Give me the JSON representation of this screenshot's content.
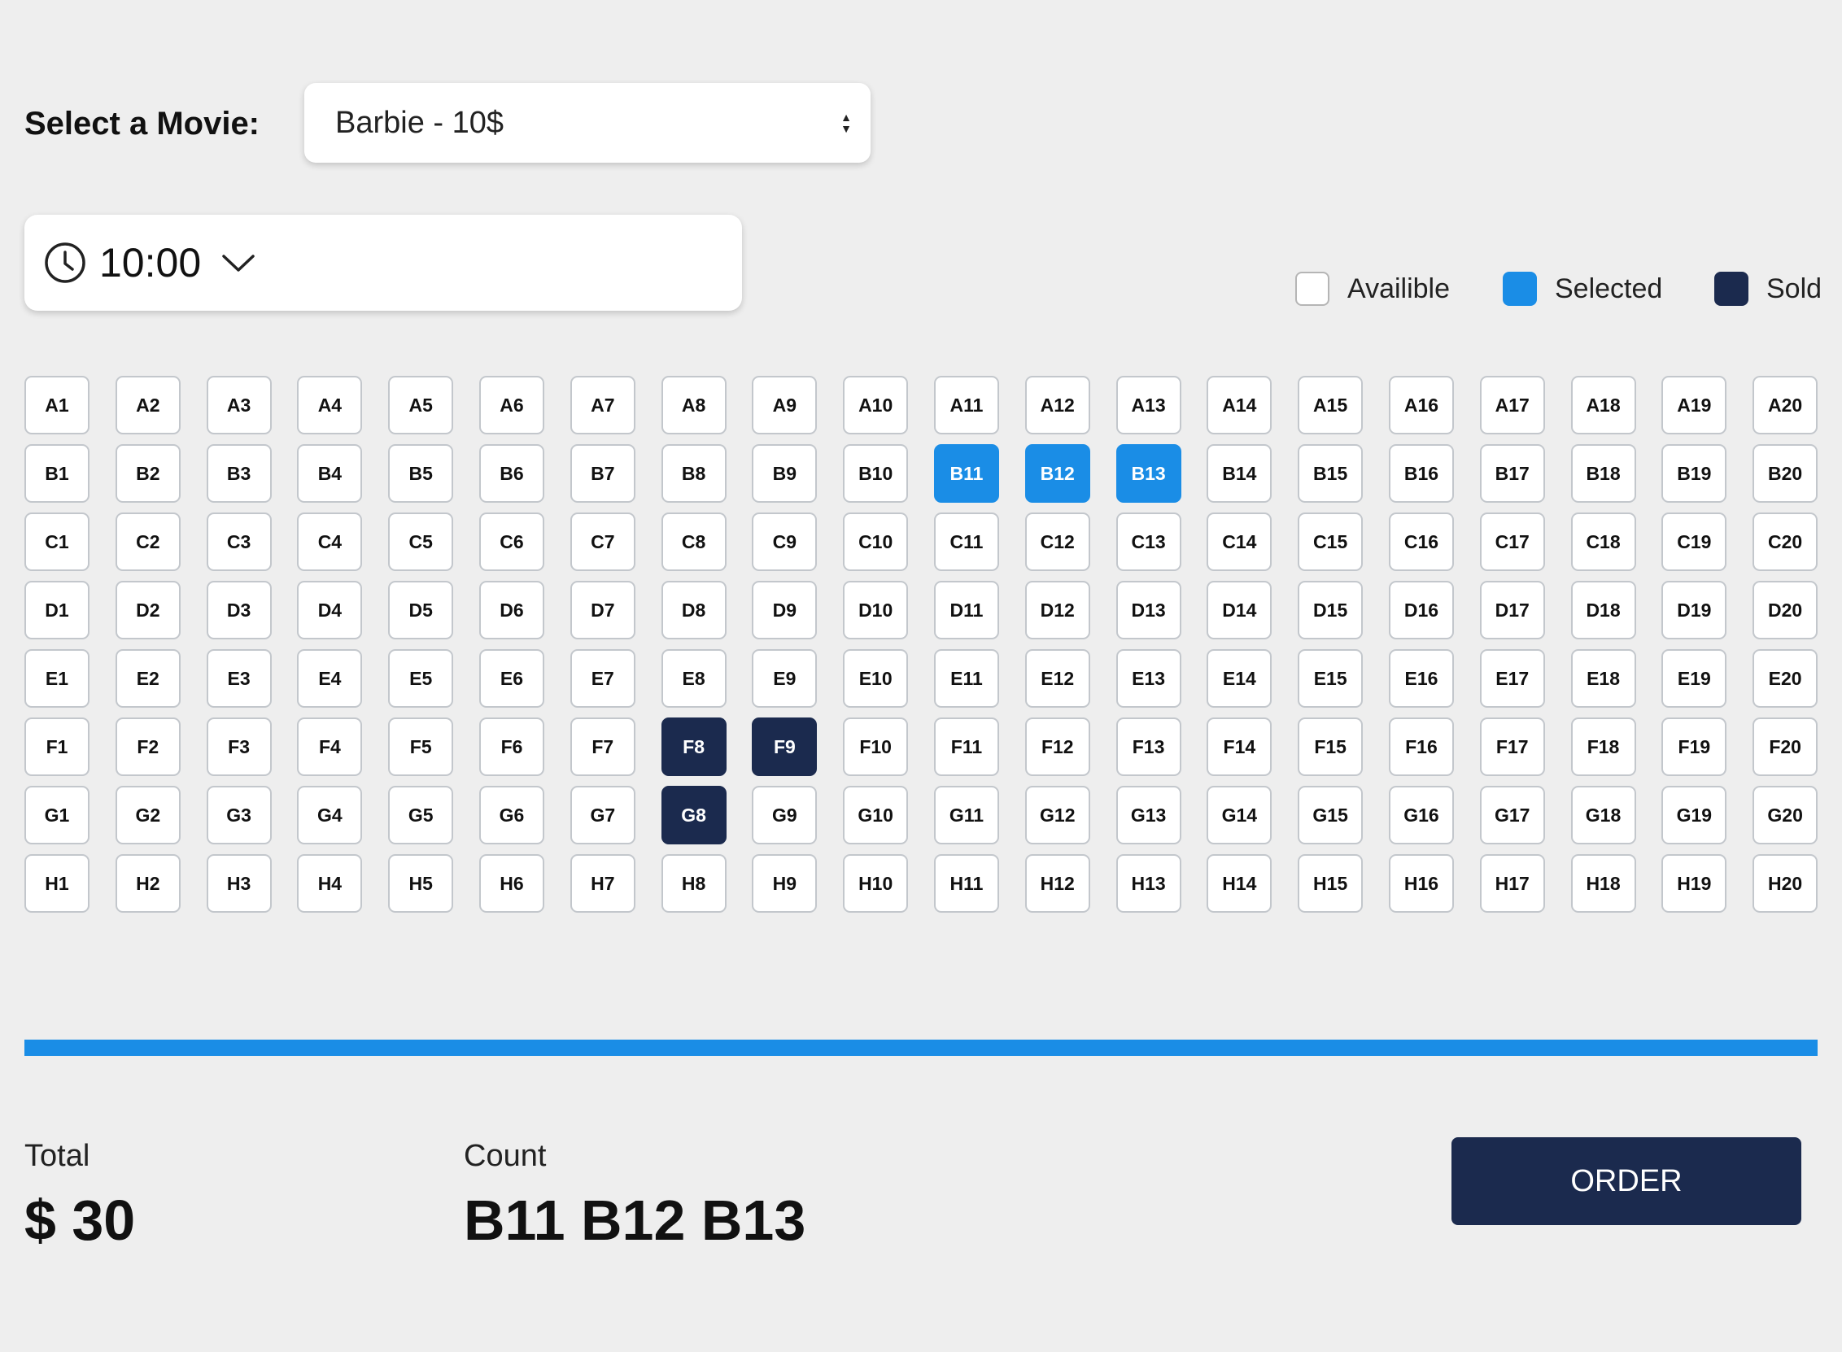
{
  "movie": {
    "label": "Select a Movie:",
    "selected": "Barbie - 10$"
  },
  "showtime": {
    "selected": "10:00"
  },
  "legend": {
    "available": "Availible",
    "selected": "Selected",
    "sold": "Sold"
  },
  "colors": {
    "selected": "#1a8de6",
    "sold": "#1b2a4e",
    "available": "#ffffff",
    "background": "#eeeeee"
  },
  "seat_grid": {
    "rows": [
      "A",
      "B",
      "C",
      "D",
      "E",
      "F",
      "G",
      "H"
    ],
    "seats_per_row": 20,
    "selected": [
      "B11",
      "B12",
      "B13"
    ],
    "sold": [
      "F8",
      "F9",
      "G8"
    ]
  },
  "summary": {
    "total_label": "Total",
    "total_value": "$ 30",
    "count_label": "Count",
    "count_value": "B11 B12 B13"
  },
  "order_button": "ORDER"
}
